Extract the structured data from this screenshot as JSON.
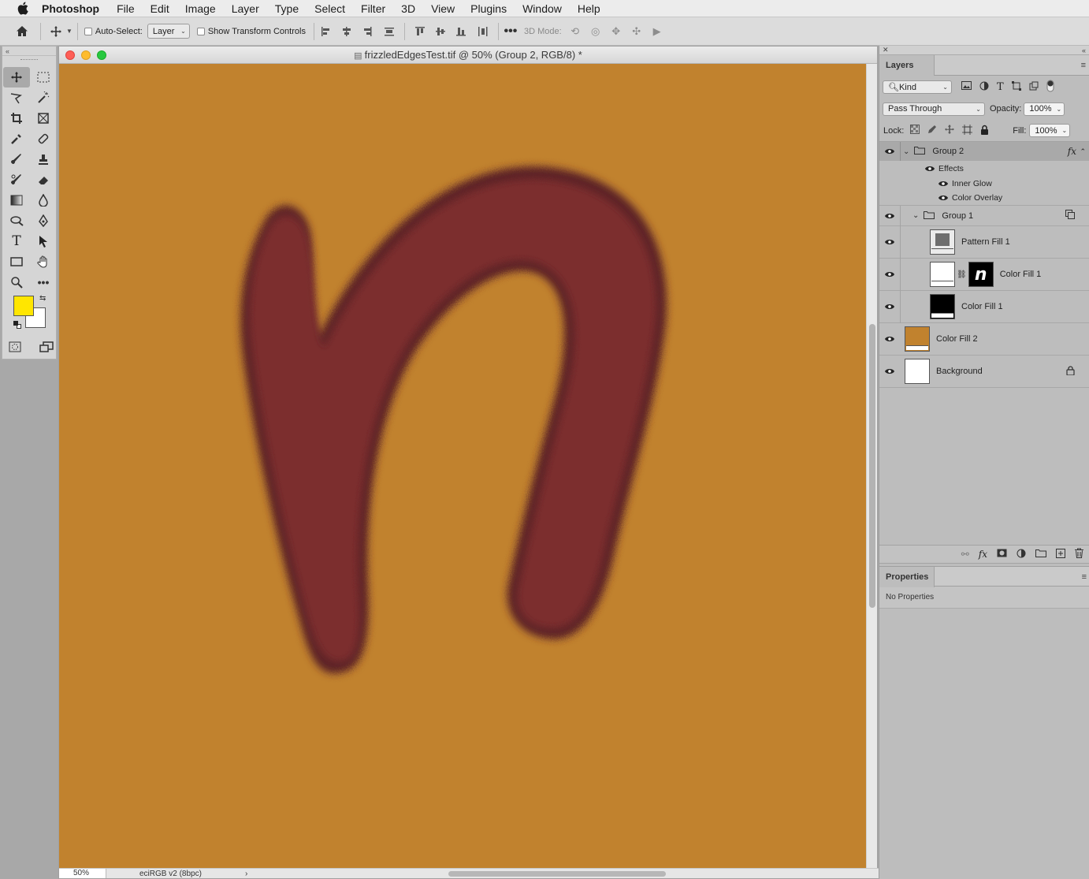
{
  "menubar": {
    "app_name": "Photoshop",
    "items": [
      "File",
      "Edit",
      "Image",
      "Layer",
      "Type",
      "Select",
      "Filter",
      "3D",
      "View",
      "Plugins",
      "Window",
      "Help"
    ]
  },
  "options": {
    "auto_select_label": "Auto-Select:",
    "auto_select_value": "Layer",
    "show_transform_label": "Show Transform Controls",
    "mode_3d_label": "3D Mode:"
  },
  "document": {
    "title": "frizzledEdgesTest.tif @ 50% (Group 2, RGB/8) *",
    "zoom": "50%",
    "profile": "eciRGB v2 (8bpc)",
    "canvas_color": "#c1822e",
    "shape_color": "#7b2e2f"
  },
  "colors": {
    "foreground": "#ffe600",
    "background": "#ffffff"
  },
  "layers_panel": {
    "tab_label": "Layers",
    "filter_value": "Kind",
    "blend_mode": "Pass Through",
    "opacity_label": "Opacity:",
    "opacity_value": "100%",
    "lock_label": "Lock:",
    "fill_label": "Fill:",
    "fill_value": "100%",
    "group2": {
      "name": "Group 2",
      "fx": "fx"
    },
    "effects_label": "Effects",
    "effects": [
      "Inner Glow",
      "Color Overlay"
    ],
    "group1": {
      "name": "Group 1"
    },
    "layers": [
      {
        "name": "Pattern Fill 1"
      },
      {
        "name": "Color Fill 1",
        "mask_glyph": "n"
      },
      {
        "name": "Color Fill 1"
      },
      {
        "name": "Color Fill 2"
      },
      {
        "name": "Background"
      }
    ]
  },
  "properties_panel": {
    "tab_label": "Properties",
    "body": "No Properties"
  }
}
